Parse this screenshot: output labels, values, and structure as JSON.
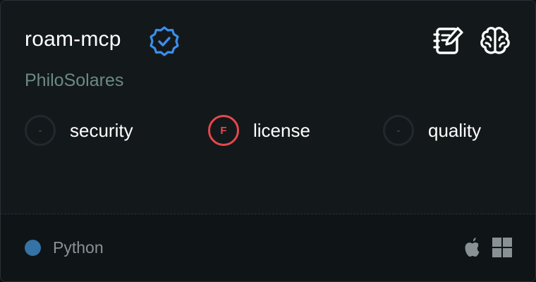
{
  "server": {
    "name": "roam-mcp",
    "author": "PhiloSolares",
    "verified_icon": "verified-badge-icon",
    "actions": [
      {
        "name": "notebook-edit-icon"
      },
      {
        "name": "brain-icon"
      }
    ]
  },
  "scores": [
    {
      "grade": "-",
      "label": "security",
      "status": "none"
    },
    {
      "grade": "F",
      "label": "license",
      "status": "fail"
    },
    {
      "grade": "-",
      "label": "quality",
      "status": "none"
    }
  ],
  "footer": {
    "language": "Python",
    "platforms": [
      "apple-icon",
      "windows-icon"
    ]
  },
  "colors": {
    "background": "#13181b",
    "footer_background": "#0f1416",
    "author": "#6b8a82",
    "verified": "#3b8eea",
    "grade_fail": "#e5484d",
    "language_python": "#3572a5",
    "platform_icon": "#8a9195"
  }
}
